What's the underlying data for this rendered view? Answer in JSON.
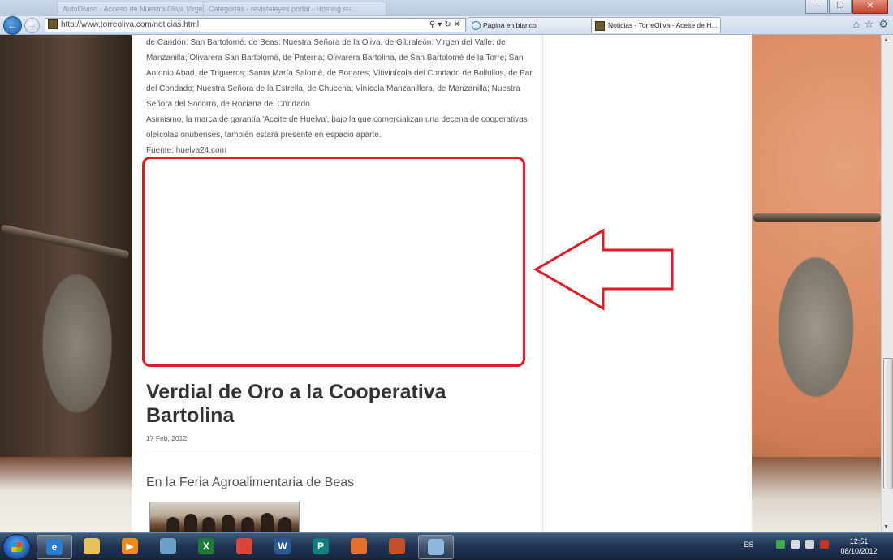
{
  "browser": {
    "ghost_tabs": [
      "AutoDiviso - Acceso de Nuestra Oliva Virgen Extra - Ju...",
      "Categorías - revistaleyes portal - Hosting su..."
    ],
    "url": "http://www.torreoliva.com/noticias.html",
    "tabs": [
      {
        "label": "Página en blanco"
      },
      {
        "label": "Noticias - TorreOliva - Aceite de H...",
        "active": true
      }
    ],
    "window_controls": {
      "minimize": "—",
      "maximize": "❐",
      "close": "✕"
    }
  },
  "article": {
    "paragraphs": [
      "de Candón; San Bartolomé, de Beas; Nuestra Señora de la Oliva, de Gibraleón; Virgen del Valle, de Manzanilla; Olivarera San Bartolomé, de Paterna; Olivarera Bartolina, de San Bartolomé de la Torre; San Antonio Abad, de Trigueros; Santa María Salomé, de Bonares; Vitivinícola del Condado de Bollullos, de Par del Condado; Nuestra Señora de la Estrella, de Chucena; Vinícola Manzanillera, de Manzanilla; Nuestra Señora del Socorro, de Rociana del Condado.",
      "Asimismo, la marca de garantía 'Aceite de Huelva', bajo la que comercializan una decena de cooperativas oleícolas onubenses, también estará presente en espacio aparte.",
      "Fuente: huelva24.com"
    ]
  },
  "post": {
    "title": "Verdial de Oro a la Cooperativa Bartolina",
    "date": "17 Feb, 2012",
    "subtitle": "En la Feria Agroalimentaria de Beas"
  },
  "annotation": {
    "color": "#e01b24"
  },
  "taskbar": {
    "apps": [
      {
        "icon": "internet-explorer-icon",
        "glyph": "e",
        "color": "#2a7bd4",
        "active": true
      },
      {
        "icon": "file-explorer-icon",
        "glyph": "",
        "color": "#e8c25a"
      },
      {
        "icon": "media-player-icon",
        "glyph": "▶",
        "color": "#f08a1c"
      },
      {
        "icon": "network-app-icon",
        "glyph": "",
        "color": "#6aa0c8"
      },
      {
        "icon": "excel-icon",
        "glyph": "X",
        "color": "#1f7a3a"
      },
      {
        "icon": "chrome-icon",
        "glyph": "",
        "color": "#d9463b"
      },
      {
        "icon": "word-icon",
        "glyph": "W",
        "color": "#2b5797"
      },
      {
        "icon": "publisher-icon",
        "glyph": "P",
        "color": "#0e7f7a"
      },
      {
        "icon": "firefox-icon",
        "glyph": "",
        "color": "#e6702a"
      },
      {
        "icon": "tool-app-icon",
        "glyph": "",
        "color": "#c4502e"
      },
      {
        "icon": "paint-icon",
        "glyph": "",
        "color": "#8fb7e0",
        "active": true
      }
    ],
    "language": "ES",
    "time": "12:51",
    "date": "08/10/2012"
  }
}
